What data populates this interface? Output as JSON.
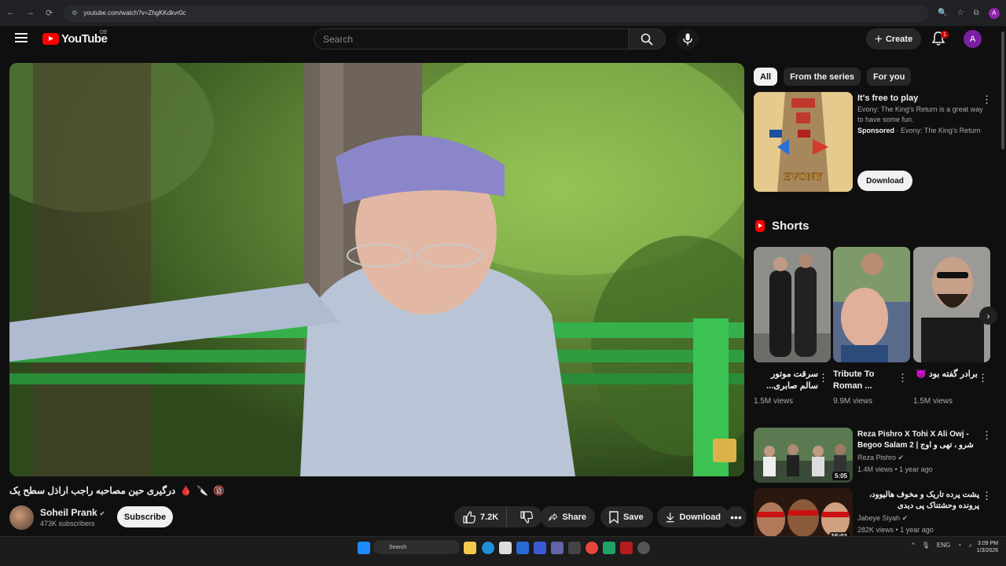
{
  "browser": {
    "url": "youtube.com/watch?v=ZhgKKdkvr0c",
    "nav_back": "←",
    "nav_forward": "→",
    "nav_reload": "⟳",
    "profile_letter": "A"
  },
  "header": {
    "logo_text": "YouTube",
    "region": "DE",
    "search_placeholder": "Search",
    "create_label": "Create",
    "notifications_count": "1",
    "avatar_letter": "A"
  },
  "video": {
    "title": "درگیری حین مصاحبه راجب اراذل سطح یک",
    "title_emojis": [
      "🩸",
      "🔪",
      "🔞"
    ],
    "channel_name": "Soheil Prank",
    "subscribers": "473K subscribers",
    "subscribe_label": "Subscribe",
    "likes": "7.2K",
    "share_label": "Share",
    "save_label": "Save",
    "download_label": "Download"
  },
  "sidebar": {
    "chips": [
      {
        "label": "All",
        "active": true
      },
      {
        "label": "From the series",
        "active": false
      },
      {
        "label": "For you",
        "active": false
      }
    ],
    "ad": {
      "title": "It's free to play",
      "description": "Evony: The King's Return is a great way to have some fun.",
      "sponsored": "Sponsored",
      "advertiser": "Evony: The King's Return",
      "thumb_text": "EVONY",
      "cta": "Download"
    },
    "shorts_title": "Shorts",
    "shorts": [
      {
        "title": "سرقت موتور سالم صابری... 😂",
        "views": "1.5M views"
      },
      {
        "title": "Tribute To Roman ...",
        "views": "9.9M views"
      },
      {
        "title": "برادر گفته بود 😈",
        "views": "1.5M views"
      }
    ],
    "recommendations": [
      {
        "title": "Reza Pishro X Tohi X Ali Owj - Begoo Salam 2 | شرو ، تهی و اوج ...",
        "channel": "Reza Pishro",
        "views": "1.4M views",
        "age": "1 year ago",
        "duration": "5:05"
      },
      {
        "title": "پشت پرده تاریک و مخوف هالیوود، پرونده وحشتناک پی دیدی",
        "channel": "Jabeye Siyah",
        "views": "282K views",
        "age": "1 year ago",
        "duration": "15:03"
      }
    ]
  },
  "taskbar": {
    "search_label": "Search",
    "time": "3:09 PM",
    "date": "1/3/2026",
    "lang": "ENG"
  },
  "colors": {
    "brand_red": "#ff0000",
    "background": "#0f0f0f",
    "chip_active": "#f1f1f1"
  }
}
